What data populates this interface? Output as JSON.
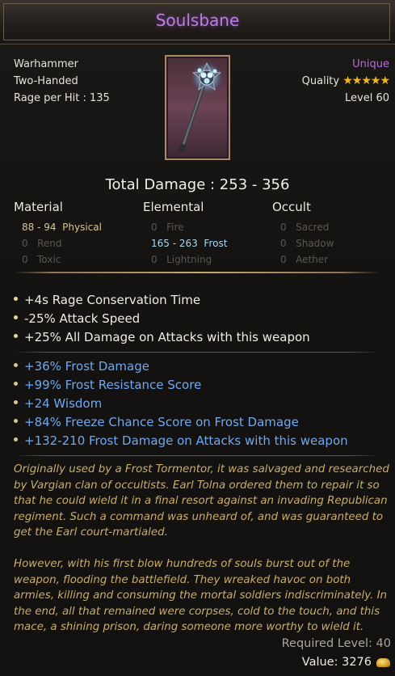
{
  "item": {
    "name": "Soulsbane",
    "type": "Warhammer",
    "handedness": "Two-Handed",
    "rage_per_hit": "Rage per Hit : 135",
    "rarity": "Unique",
    "quality_label": "Quality",
    "quality_stars": "★★★★★",
    "quality_rating": 5,
    "level": "Level 60",
    "image_icon": "mace-weapon-icon"
  },
  "damage": {
    "total": "Total Damage : 253 - 356",
    "material": {
      "header": "Material",
      "rows": [
        {
          "value": "88 - 94",
          "type": "Physical"
        },
        {
          "value": "0",
          "type": "Rend"
        },
        {
          "value": "0",
          "type": "Toxic"
        }
      ]
    },
    "elemental": {
      "header": "Elemental",
      "rows": [
        {
          "value": "0",
          "type": "Fire"
        },
        {
          "value": "165 - 263",
          "type": "Frost"
        },
        {
          "value": "0",
          "type": "Lightning"
        }
      ]
    },
    "occult": {
      "header": "Occult",
      "rows": [
        {
          "value": "0",
          "type": "Sacred"
        },
        {
          "value": "0",
          "type": "Shadow"
        },
        {
          "value": "0",
          "type": "Aether"
        }
      ]
    }
  },
  "base_affixes": [
    "+4s Rage Conservation Time",
    "-25% Attack Speed",
    "+25% All Damage on Attacks with this weapon"
  ],
  "magic_affixes": [
    "+36% Frost Damage",
    "+99% Frost Resistance Score",
    "+24 Wisdom",
    "+84% Freeze Chance Score on Frost Damage",
    "+132-210 Frost Damage on Attacks with this weapon"
  ],
  "lore": [
    "Originally used by a Frost Tormentor, it was salvaged and researched by Vargian clan of occultists. Earl Tolna ordered them to repair it so that he could wield it in a final resort against an invading Republican regiment. Such a command was unheard of, and was guaranteed to get the Earl court-martialed.",
    "However, with his first blow hundreds of souls burst out of the weapon, flooding the battlefield. They wreaked havoc on both armies, killing and consuming the mortal soldiers indiscriminately. In the end, all that remained were corpses, cold to the touch, and this mace, a shining prison, daring someone more worthy to wield it."
  ],
  "footer": {
    "required_level": "Required Level: 40",
    "value": "Value: 3276",
    "currency_icon": "gold-coins-icon"
  },
  "colors": {
    "unique": "#c07be8",
    "frost": "#6fa8f0",
    "lore": "#c9ad6a",
    "star": "#f0b820"
  }
}
